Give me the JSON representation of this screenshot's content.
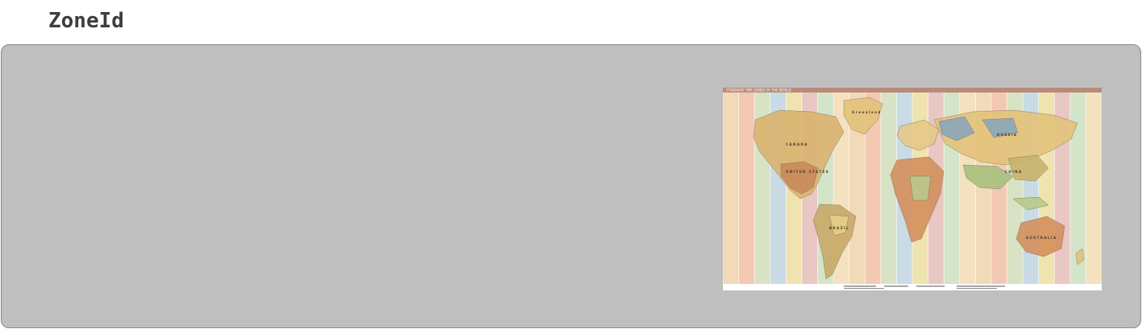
{
  "header": {
    "title": "ZoneId"
  },
  "image": {
    "alt": "Standard time zones of the world map",
    "caption": "STANDARD TIME ZONES OF THE WORLD",
    "labels": {
      "greenland": "Greenland",
      "canada": "CANADA",
      "united_states": "UNITED STATES",
      "brazil": "BRAZIL",
      "russia": "RUSSIA",
      "china": "CHINA",
      "australia": "AUSTRALIA"
    }
  },
  "colors": {
    "panel_background": "#bfbfbf",
    "panel_border": "#8a8a8a",
    "title_text": "#3d3d3d",
    "map_header_bar": "#b88a7a"
  }
}
